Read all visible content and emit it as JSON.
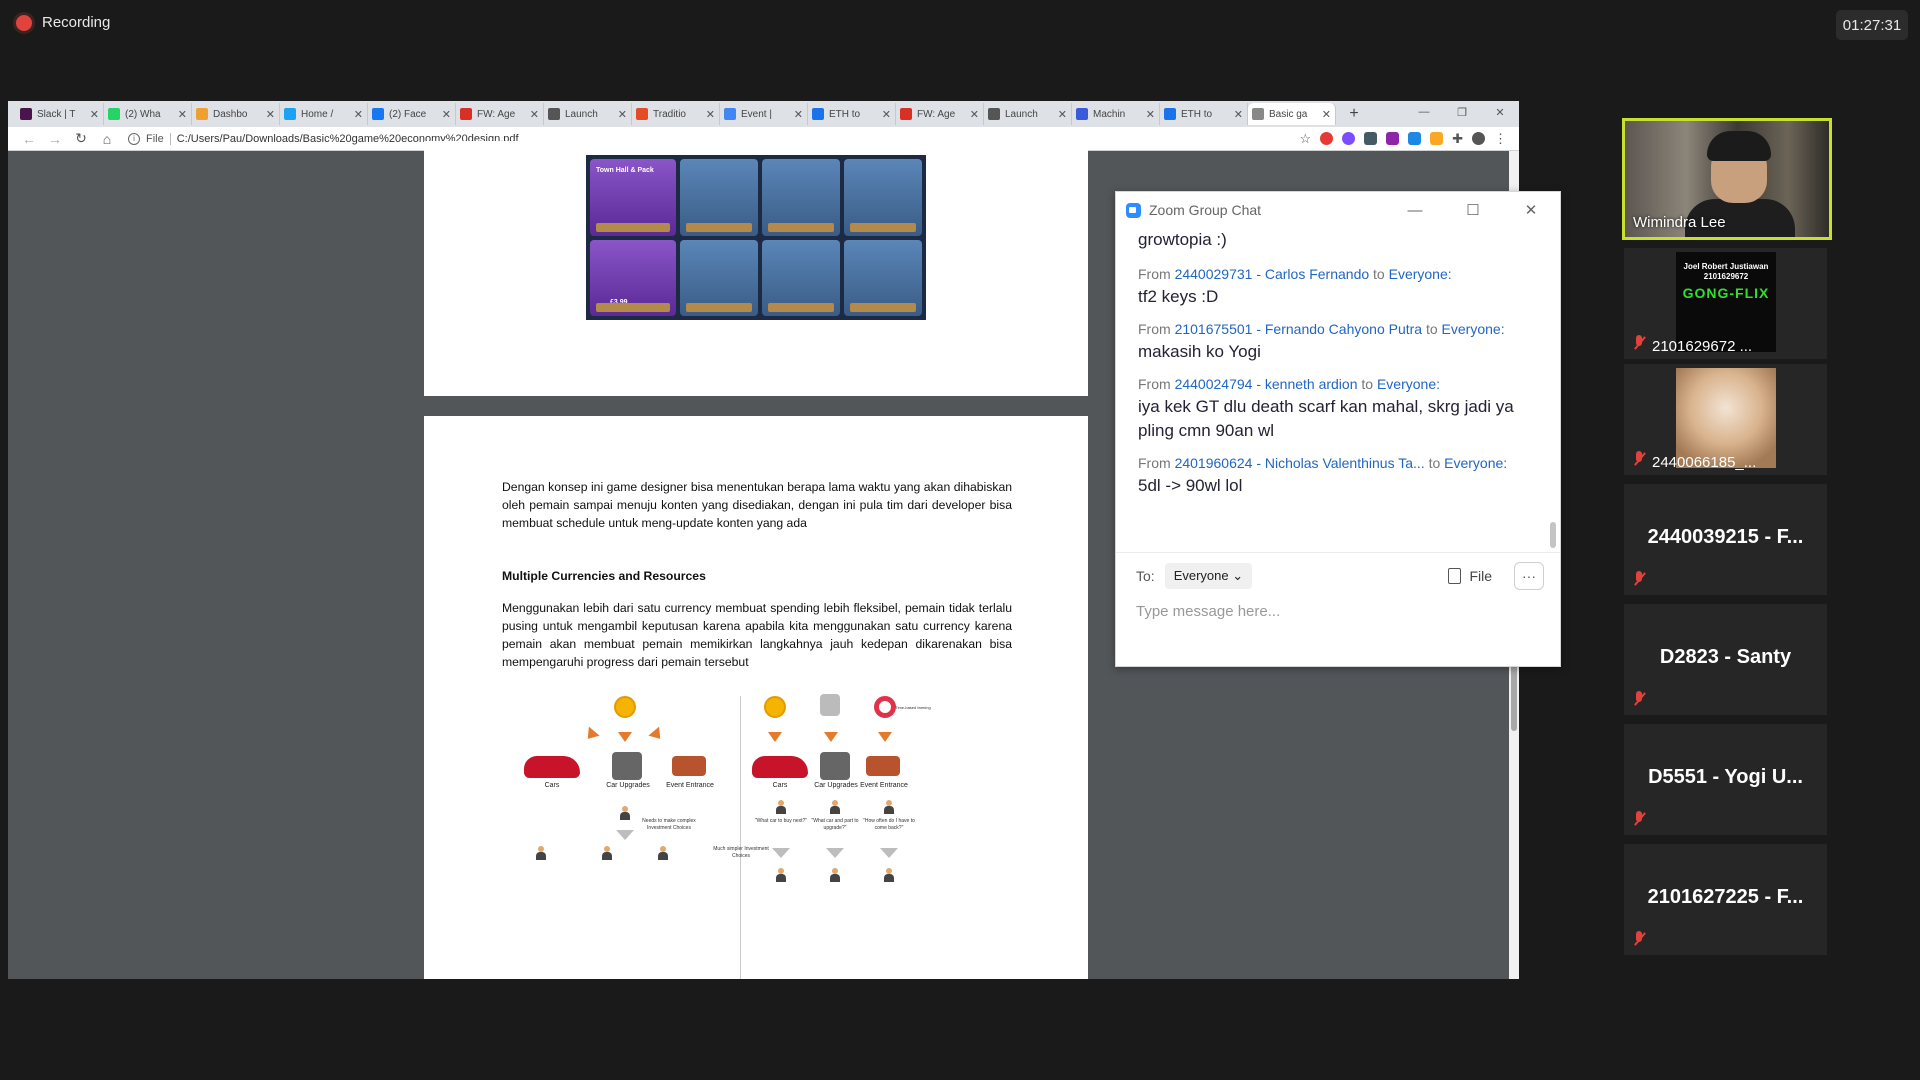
{
  "recording": {
    "label": "Recording"
  },
  "timer": "01:27:31",
  "browser": {
    "tabs": [
      {
        "title": "Slack | T",
        "color": "#4a154b"
      },
      {
        "title": "(2) Wha",
        "color": "#25d366"
      },
      {
        "title": "Dashbo",
        "color": "#f0a030"
      },
      {
        "title": "Home /",
        "color": "#1da1f2"
      },
      {
        "title": "(2) Face",
        "color": "#1877f2"
      },
      {
        "title": "FW: Age",
        "color": "#d93025"
      },
      {
        "title": "Launch",
        "color": "#555555"
      },
      {
        "title": "Traditio",
        "color": "#e34c26"
      },
      {
        "title": "Event |",
        "color": "#4285f4"
      },
      {
        "title": "ETH to",
        "color": "#1a73e8"
      },
      {
        "title": "FW: Age",
        "color": "#d93025"
      },
      {
        "title": "Launch",
        "color": "#555555"
      },
      {
        "title": "Machin",
        "color": "#3b5bdb"
      },
      {
        "title": "ETH to",
        "color": "#1a73e8"
      },
      {
        "title": "Basic ga",
        "color": "#888888"
      }
    ],
    "new_tab": "+",
    "file_label": "File",
    "url": "C:/Users/Pau/Downloads/Basic%20game%20economy%20design.pdf"
  },
  "pdf": {
    "page1_image": {
      "title": "Town Hall & Pack",
      "price": "£3.99"
    },
    "para1": "Dengan konsep ini game designer bisa menentukan berapa lama waktu yang akan dihabiskan oleh pemain sampai menuju konten yang disediakan, dengan ini pula tim dari developer bisa membuat schedule untuk meng-update konten yang ada",
    "heading": "Multiple Currencies and Resources",
    "para2": "Menggunakan lebih dari satu currency membuat spending lebih fleksibel, pemain tidak terlalu pusing untuk mengambil keputusan karena apabila kita menggunakan satu currency karena pemain akan membuat pemain memikirkan langkahnya jauh kedepan dikarenakan bisa mempengaruhi progress dari pemain tersebut",
    "diagram": {
      "left_labels": [
        "Cars",
        "Car Upgrades",
        "Event Entrance"
      ],
      "right_labels": [
        "Cars",
        "Car Upgrades",
        "Event Entrance"
      ],
      "left_note": "Needs to make complex Investment Choices",
      "right_note": "Much simpler Investment Choices",
      "time_note": "Time-based farming",
      "q1": "\"What car to buy next?\"",
      "q2": "\"What car and part to upgrade?\"",
      "q3": "\"How often do I have to come back?\""
    }
  },
  "chat": {
    "title": "Zoom Group Chat",
    "first_text": "growtopia :)",
    "from_label": "From",
    "to_label": "to",
    "messages": [
      {
        "sender": "2440029731 - Carlos Fernando",
        "recipient": "Everyone:",
        "text": "tf2 keys :D"
      },
      {
        "sender": "2101675501 - Fernando Cahyono Putra",
        "recipient": "Everyone:",
        "text": "makasih ko Yogi"
      },
      {
        "sender": "2440024794 - kenneth ardion",
        "recipient": "Everyone:",
        "text": "iya kek GT dlu death scarf kan mahal, skrg jadi ya pling cmn 90an wl"
      },
      {
        "sender": "2401960624 - Nicholas Valenthinus Ta...",
        "recipient": "Everyone:",
        "text": "5dl -> 90wl lol"
      }
    ],
    "to": "To:",
    "recipient_select": "Everyone",
    "file_button": "File",
    "more": "···",
    "input_placeholder": "Type message here..."
  },
  "participants": [
    {
      "name": "Wimindra Lee"
    },
    {
      "name": "2101629672 ..."
    },
    {
      "name": "2440066185_..."
    },
    {
      "name": "2440039215 - F..."
    },
    {
      "name": "D2823 - Santy"
    },
    {
      "name": "D5551 - Yogi U..."
    },
    {
      "name": "2101627225 - F..."
    }
  ],
  "poster": {
    "line1": "Joel Robert Justiawan",
    "line2": "2101629672",
    "line3": "GONG-FLIX"
  }
}
